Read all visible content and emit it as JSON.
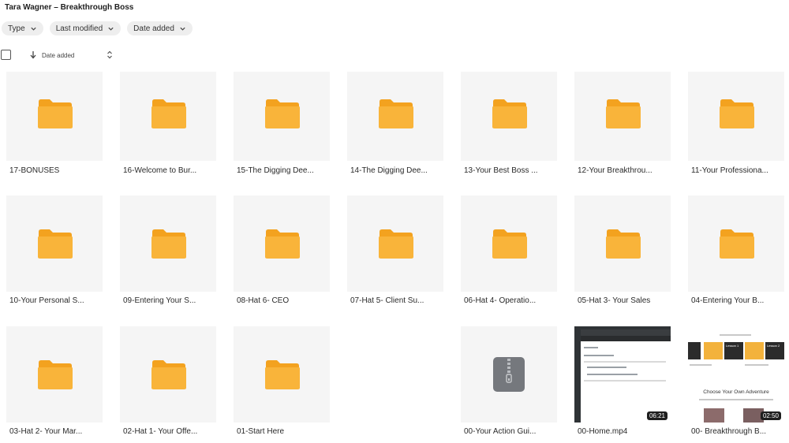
{
  "header": {
    "title": "Tara Wagner – Breakthrough Boss"
  },
  "filters": [
    {
      "label": "Type"
    },
    {
      "label": "Last modified"
    },
    {
      "label": "Date added"
    }
  ],
  "sort": {
    "label": "Date added"
  },
  "items": [
    {
      "name": "17-BONUSES",
      "kind": "folder"
    },
    {
      "name": "16-Welcome to Bur...",
      "kind": "folder"
    },
    {
      "name": "15-The Digging Dee...",
      "kind": "folder"
    },
    {
      "name": "14-The Digging Dee...",
      "kind": "folder"
    },
    {
      "name": "13-Your Best Boss ...",
      "kind": "folder"
    },
    {
      "name": "12-Your Breakthrou...",
      "kind": "folder"
    },
    {
      "name": "11-Your Professiona...",
      "kind": "folder"
    },
    {
      "name": "10-Your Personal S...",
      "kind": "folder"
    },
    {
      "name": "09-Entering Your S...",
      "kind": "folder"
    },
    {
      "name": "08-Hat 6- CEO",
      "kind": "folder"
    },
    {
      "name": "07-Hat 5- Client Su...",
      "kind": "folder"
    },
    {
      "name": "06-Hat 4- Operatio...",
      "kind": "folder"
    },
    {
      "name": "05-Hat 3- Your Sales",
      "kind": "folder"
    },
    {
      "name": "04-Entering Your B...",
      "kind": "folder"
    },
    {
      "name": "03-Hat 2- Your Mar...",
      "kind": "folder"
    },
    {
      "name": "02-Hat 1- Your Offe...",
      "kind": "folder"
    },
    {
      "name": "01-Start Here",
      "kind": "folder"
    },
    {
      "name": "00-Your Action Gui...",
      "kind": "zip"
    },
    {
      "name": "00-Home.mp4",
      "kind": "video",
      "duration": "06:21"
    },
    {
      "name": "00- Breakthrough B...",
      "kind": "video",
      "duration": "02:50",
      "slide_heading": "Choose Your Own Adventure",
      "card_1": "Lesson 1",
      "card_2": "Lesson 2"
    }
  ],
  "colors": {
    "folder": "#f9b43a",
    "folder_tab": "#f3a21f",
    "tile_bg": "#f5f5f5",
    "zip": "#75787d"
  }
}
